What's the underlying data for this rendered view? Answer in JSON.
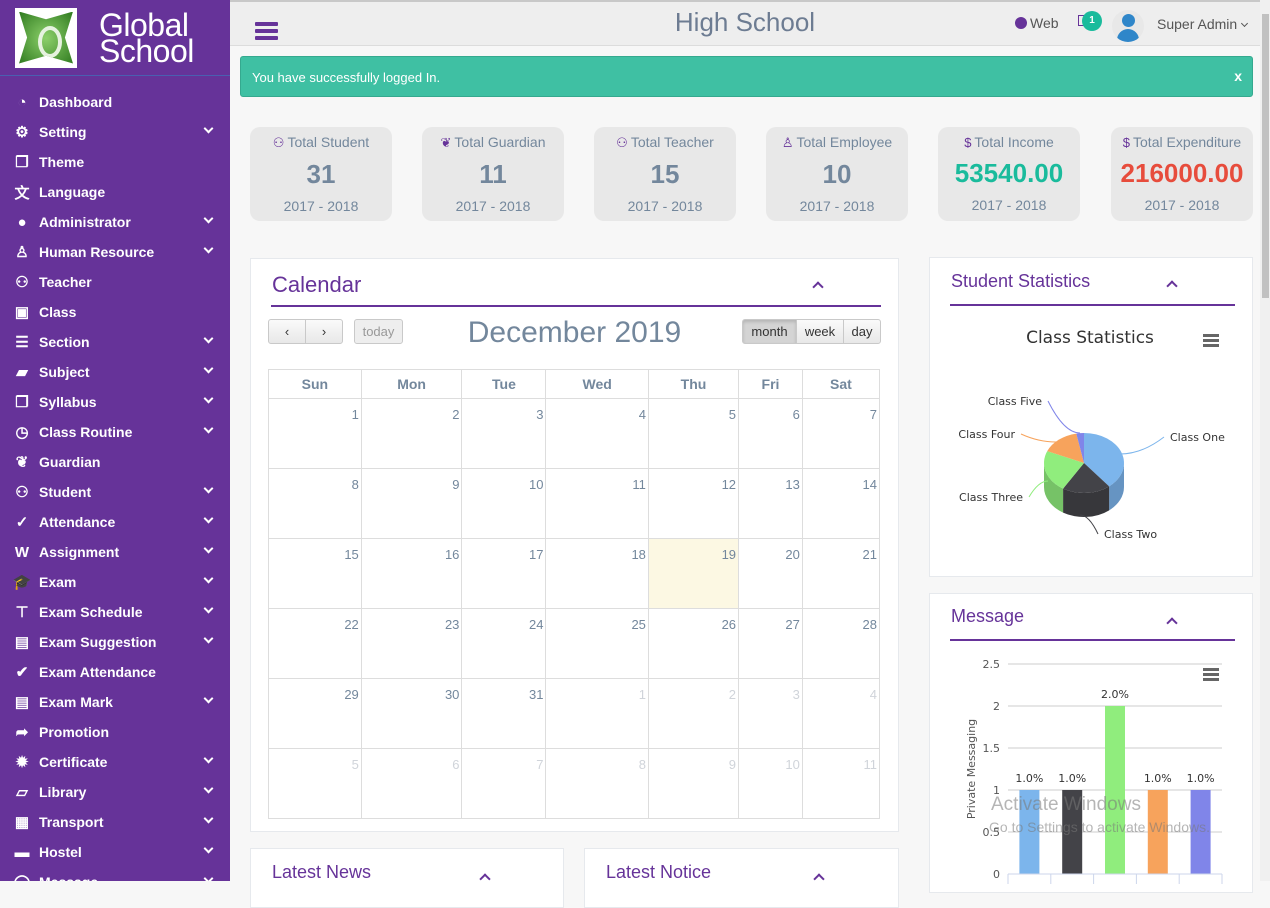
{
  "brand": {
    "name_line1": "Global",
    "name_line2": "School"
  },
  "sidebar": {
    "items": [
      {
        "label": "Dashboard",
        "icon": "dashboard-icon",
        "glyph": "◔",
        "has_submenu": false
      },
      {
        "label": "Setting",
        "icon": "gears-icon",
        "glyph": "⚙",
        "has_submenu": true
      },
      {
        "label": "Theme",
        "icon": "cubes-icon",
        "glyph": "❒",
        "has_submenu": false
      },
      {
        "label": "Language",
        "icon": "language-icon",
        "glyph": "文",
        "has_submenu": false
      },
      {
        "label": "Administrator",
        "icon": "user-icon",
        "glyph": "●",
        "has_submenu": true
      },
      {
        "label": "Human Resource",
        "icon": "user-md-icon",
        "glyph": "♙",
        "has_submenu": true
      },
      {
        "label": "Teacher",
        "icon": "users-icon",
        "glyph": "⚇",
        "has_submenu": false
      },
      {
        "label": "Class",
        "icon": "slideshare-icon",
        "glyph": "▣",
        "has_submenu": false
      },
      {
        "label": "Section",
        "icon": "bars-icon",
        "glyph": "☰",
        "has_submenu": true
      },
      {
        "label": "Subject",
        "icon": "folder-open-icon",
        "glyph": "▰",
        "has_submenu": true
      },
      {
        "label": "Syllabus",
        "icon": "files-icon",
        "glyph": "❐",
        "has_submenu": true
      },
      {
        "label": "Class Routine",
        "icon": "clock-icon",
        "glyph": "◷",
        "has_submenu": true
      },
      {
        "label": "Guardian",
        "icon": "paw-icon",
        "glyph": "❦",
        "has_submenu": false
      },
      {
        "label": "Student",
        "icon": "users-icon",
        "glyph": "⚇",
        "has_submenu": true
      },
      {
        "label": "Attendance",
        "icon": "check-circle-icon",
        "glyph": "✓",
        "has_submenu": true
      },
      {
        "label": "Assignment",
        "icon": "file-word-icon",
        "glyph": "W",
        "has_submenu": true
      },
      {
        "label": "Exam",
        "icon": "graduation-cap-icon",
        "glyph": "🎓",
        "has_submenu": true
      },
      {
        "label": "Exam Schedule",
        "icon": "thumbtack-icon",
        "glyph": "⊤",
        "has_submenu": true
      },
      {
        "label": "Exam Suggestion",
        "icon": "file-text-icon",
        "glyph": "▤",
        "has_submenu": true
      },
      {
        "label": "Exam Attendance",
        "icon": "check-icon",
        "glyph": "✔",
        "has_submenu": false
      },
      {
        "label": "Exam Mark",
        "icon": "file-text-o-icon",
        "glyph": "▤",
        "has_submenu": true
      },
      {
        "label": "Promotion",
        "icon": "share-icon",
        "glyph": "➦",
        "has_submenu": false
      },
      {
        "label": "Certificate",
        "icon": "certificate-icon",
        "glyph": "✹",
        "has_submenu": true
      },
      {
        "label": "Library",
        "icon": "book-icon",
        "glyph": "▱",
        "has_submenu": true
      },
      {
        "label": "Transport",
        "icon": "bus-icon",
        "glyph": "▦",
        "has_submenu": true
      },
      {
        "label": "Hostel",
        "icon": "bed-icon",
        "glyph": "▬",
        "has_submenu": true
      },
      {
        "label": "Message",
        "icon": "comments-icon",
        "glyph": "◯",
        "has_submenu": true
      }
    ]
  },
  "topbar": {
    "title": "High School",
    "web_label": "Web",
    "mail_badge": "1",
    "user_name": "Super Admin"
  },
  "alert": {
    "message": "You have successfully logged In.",
    "close_label": "x"
  },
  "stats": [
    {
      "label": "Total Student",
      "glyph": "⚇",
      "value": "31",
      "year": "2017 - 2018",
      "color": "#73879c"
    },
    {
      "label": "Total Guardian",
      "glyph": "❦",
      "value": "11",
      "year": "2017 - 2018",
      "color": "#73879c"
    },
    {
      "label": "Total Teacher",
      "glyph": "⚇",
      "value": "15",
      "year": "2017 - 2018",
      "color": "#73879c"
    },
    {
      "label": "Total Employee",
      "glyph": "♙",
      "value": "10",
      "year": "2017 - 2018",
      "color": "#73879c"
    },
    {
      "label": "Total Income",
      "glyph": "$",
      "value": "53540.00",
      "year": "2017 - 2018",
      "color": "#1abb9c"
    },
    {
      "label": "Total Expenditure",
      "glyph": "$",
      "value": "216000.00",
      "year": "2017 - 2018",
      "color": "#e74c3c"
    }
  ],
  "calendar": {
    "panel_title": "Calendar",
    "prev_label": "‹",
    "next_label": "›",
    "today_label": "today",
    "title": "December 2019",
    "views": [
      "month",
      "week",
      "day"
    ],
    "active_view": "month",
    "weekdays": [
      "Sun",
      "Mon",
      "Tue",
      "Wed",
      "Thu",
      "Fri",
      "Sat"
    ],
    "weeks": [
      [
        {
          "d": "1"
        },
        {
          "d": "2"
        },
        {
          "d": "3"
        },
        {
          "d": "4"
        },
        {
          "d": "5"
        },
        {
          "d": "6"
        },
        {
          "d": "7"
        }
      ],
      [
        {
          "d": "8"
        },
        {
          "d": "9"
        },
        {
          "d": "10"
        },
        {
          "d": "11"
        },
        {
          "d": "12"
        },
        {
          "d": "13"
        },
        {
          "d": "14"
        }
      ],
      [
        {
          "d": "15"
        },
        {
          "d": "16"
        },
        {
          "d": "17"
        },
        {
          "d": "18"
        },
        {
          "d": "19",
          "today": true
        },
        {
          "d": "20"
        },
        {
          "d": "21"
        }
      ],
      [
        {
          "d": "22"
        },
        {
          "d": "23"
        },
        {
          "d": "24"
        },
        {
          "d": "25"
        },
        {
          "d": "26"
        },
        {
          "d": "27"
        },
        {
          "d": "28"
        }
      ],
      [
        {
          "d": "29"
        },
        {
          "d": "30"
        },
        {
          "d": "31"
        },
        {
          "d": "1",
          "other": true
        },
        {
          "d": "2",
          "other": true
        },
        {
          "d": "3",
          "other": true
        },
        {
          "d": "4",
          "other": true
        }
      ],
      [
        {
          "d": "5",
          "other": true
        },
        {
          "d": "6",
          "other": true
        },
        {
          "d": "7",
          "other": true
        },
        {
          "d": "8",
          "other": true
        },
        {
          "d": "9",
          "other": true
        },
        {
          "d": "10",
          "other": true
        },
        {
          "d": "11",
          "other": true
        }
      ]
    ]
  },
  "student_stats": {
    "panel_title": "Student Statistics"
  },
  "message_panel": {
    "panel_title": "Message"
  },
  "latest_news": {
    "panel_title": "Latest News"
  },
  "latest_notice": {
    "panel_title": "Latest Notice"
  },
  "watermark": {
    "line1": "Activate Windows",
    "line2": "Go to Settings to activate Windows."
  },
  "chart_data": [
    {
      "type": "pie",
      "title": "Class Statistics",
      "categories": [
        "Class One",
        "Class Two",
        "Class Three",
        "Class Four",
        "Class Five"
      ],
      "values": [
        38,
        19,
        22,
        15,
        3
      ],
      "colors": [
        "#7cb5ec",
        "#434348",
        "#90ed7d",
        "#f7a35c",
        "#8085e9"
      ],
      "legend": "none"
    },
    {
      "type": "bar",
      "title": "",
      "ylabel": "Private Messaging",
      "ylim": [
        0,
        2.5
      ],
      "yticks": [
        "0",
        "0.5",
        "1",
        "1.5",
        "2",
        "2.5"
      ],
      "values": [
        1,
        1,
        2,
        1,
        1
      ],
      "data_labels": [
        "1.0%",
        "1.0%",
        "2.0%",
        "1.0%",
        "1.0%"
      ],
      "colors": [
        "#7cb5ec",
        "#434348",
        "#90ed7d",
        "#f7a35c",
        "#8085e9"
      ],
      "grid": true
    }
  ]
}
